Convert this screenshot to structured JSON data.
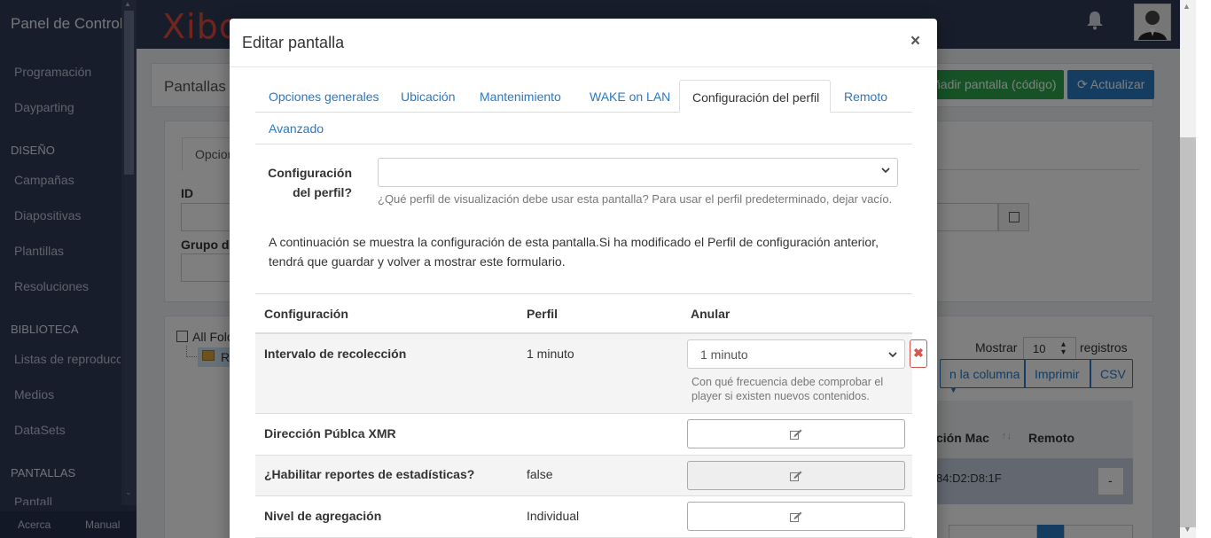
{
  "app": {
    "sidebar_title": "Panel de Control",
    "logo_text": "Xibo",
    "nav": [
      {
        "type": "item",
        "label": "Programación"
      },
      {
        "type": "item",
        "label": "Dayparting"
      },
      {
        "type": "heading",
        "label": "DISEÑO"
      },
      {
        "type": "item",
        "label": "Campañas"
      },
      {
        "type": "item",
        "label": "Diapositivas"
      },
      {
        "type": "item",
        "label": "Plantillas"
      },
      {
        "type": "item",
        "label": "Resoluciones"
      },
      {
        "type": "heading",
        "label": "BIBLIOTECA"
      },
      {
        "type": "item",
        "label": "Listas de reproducci"
      },
      {
        "type": "item",
        "label": "Medios"
      },
      {
        "type": "item",
        "label": "DataSets"
      },
      {
        "type": "heading",
        "label": "PANTALLAS"
      },
      {
        "type": "item",
        "label": "Pantall"
      }
    ],
    "footer": {
      "about": "Acerca",
      "manual": "Manual"
    }
  },
  "background": {
    "page_title": "Pantallas",
    "add_display_button": "ñadir pantalla (código)",
    "refresh_button": "Actualizar",
    "filter_tab": "Opcior",
    "id_label": "ID",
    "group_label": "Grupo d",
    "folder_label": "All Folo",
    "folder_child": "R",
    "show_label": "Mostrar",
    "page_size": "10",
    "records_label": "registros",
    "column_button": "n la columna",
    "print_button": "Imprimir",
    "csv_button": "CSV",
    "col_mac": "ción Mac",
    "col_remote": "Remoto",
    "mac_value": "84:D2:D8:1F",
    "action_caret": "-"
  },
  "modal": {
    "title": "Editar pantalla",
    "close": "×",
    "tabs": [
      {
        "label": "Opciones generales",
        "active": false
      },
      {
        "label": "Ubicación",
        "active": false
      },
      {
        "label": "Mantenimiento",
        "active": false
      },
      {
        "label": "WAKE on LAN",
        "active": false
      },
      {
        "label": "Configuración del perfil",
        "active": true
      },
      {
        "label": "Remoto",
        "active": false
      },
      {
        "label": "Avanzado",
        "active": false
      }
    ],
    "profile_label_line1": "Configuración",
    "profile_label_line2": "del perfil?",
    "profile_value": "",
    "profile_help": "¿Qué perfil de visualización debe usar esta pantalla? Para usar el perfil predeterminado, dejar vacío.",
    "info_line1": "A continuación se muestra la configuración de esta pantalla.Si ha modificado el Perfil de configuración anterior,",
    "info_line2": "tendrá que guardar y volver a mostrar este formulario.",
    "table": {
      "headers": {
        "setting": "Configuración",
        "profile": "Perfil",
        "override": "Anular"
      },
      "rows": [
        {
          "name": "Intervalo de recolección",
          "profile": "1 minuto",
          "override_value": "1 minuto",
          "help": "Con qué frecuencia debe comprobar el",
          "help2": "player si existen nuevos contenidos."
        },
        {
          "name": "Dirección Públca XMR",
          "profile": ""
        },
        {
          "name": "¿Habilitar reportes de estadísticas?",
          "profile": "false"
        },
        {
          "name": "Nivel de agregación",
          "profile": "Individual"
        }
      ]
    }
  }
}
